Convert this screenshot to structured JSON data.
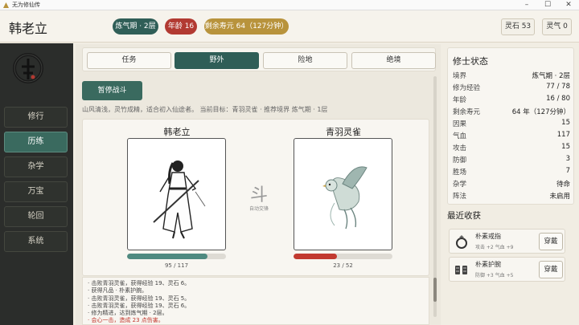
{
  "window": {
    "title": "无为修仙传"
  },
  "header": {
    "name": "韩老立",
    "realm": "炼气期 · 2层",
    "age": "年龄 16",
    "lifespan": "剩余寿元 64（127分钟）",
    "spirit_stone": "灵石 53",
    "spirit_qi": "灵气 0"
  },
  "sidebar": {
    "items": [
      {
        "label": "修行"
      },
      {
        "label": "历练"
      },
      {
        "label": "杂学"
      },
      {
        "label": "万宝"
      },
      {
        "label": "轮回"
      },
      {
        "label": "系统"
      }
    ]
  },
  "tabs": [
    {
      "label": "任务"
    },
    {
      "label": "野外"
    },
    {
      "label": "险地"
    },
    {
      "label": "绝境"
    }
  ],
  "battle": {
    "pause_label": "暂停战斗",
    "info": "山风清浅，灵竹成精，适合初入仙途者。    当前目标：青羽灵雀    ·    推荐境界 炼气期 · 1层",
    "vs_char": "斗",
    "vs_sub": "自动交锋",
    "player": {
      "name": "韩老立",
      "hp": 95,
      "hp_max": 117,
      "hp_text": "95 / 117",
      "hp_color": "#4f8a80"
    },
    "enemy": {
      "name": "青羽灵雀",
      "hp": 23,
      "hp_max": 52,
      "hp_text": "23 / 52",
      "hp_color": "#c23a30"
    }
  },
  "log": [
    {
      "text": "· 击败青羽灵雀，获得经验 19、灵石 6。",
      "crit": false
    },
    {
      "text": "· 获得凡品 · 朴素护腕。",
      "crit": false
    },
    {
      "text": "· 击败青羽灵雀，获得经验 19、灵石 5。",
      "crit": false
    },
    {
      "text": "· 击败青羽灵雀，获得经验 19、灵石 6。",
      "crit": false
    },
    {
      "text": "· 修为精进，达到炼气期 · 2层。",
      "crit": false
    },
    {
      "text": "· 会心一击，造成 23 点伤害。",
      "crit": true
    }
  ],
  "status": {
    "title": "修士状态",
    "rows": [
      {
        "k": "境界",
        "v": "炼气期 · 2层"
      },
      {
        "k": "修为经验",
        "v": "77 / 78"
      },
      {
        "k": "年龄",
        "v": "16 / 80"
      },
      {
        "k": "剩余寿元",
        "v": "64 年（127分钟）"
      },
      {
        "k": "因果",
        "v": "15"
      },
      {
        "k": "气血",
        "v": "117"
      },
      {
        "k": "攻击",
        "v": "15"
      },
      {
        "k": "防御",
        "v": "3"
      },
      {
        "k": "胜场",
        "v": "7"
      },
      {
        "k": "杂学",
        "v": "待命"
      },
      {
        "k": "阵法",
        "v": "未启用"
      }
    ]
  },
  "rewards": {
    "title": "最近收获",
    "items": [
      {
        "name": "朴素戒指",
        "stats": "攻击 +2    气血 +9",
        "action": "穿戴",
        "icon": "ring-icon"
      },
      {
        "name": "朴素护腕",
        "stats": "防御 +3    气血 +5",
        "action": "穿戴",
        "icon": "bracer-icon"
      }
    ]
  }
}
